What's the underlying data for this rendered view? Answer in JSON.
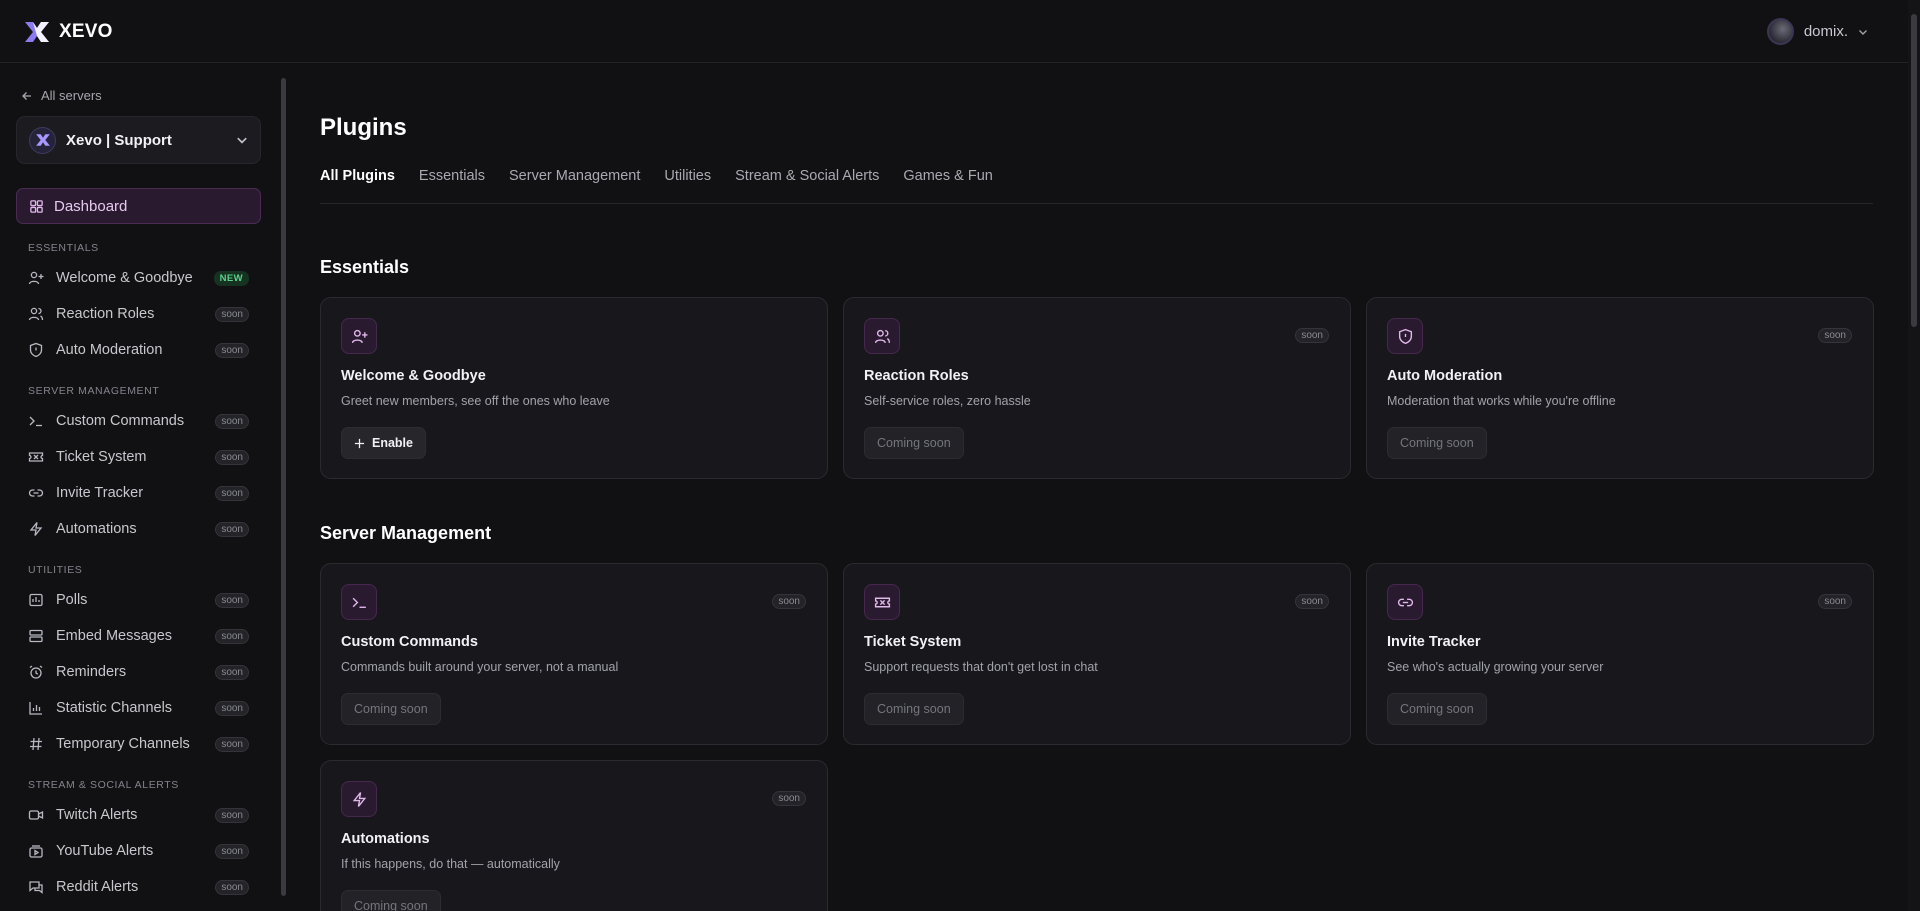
{
  "brand": {
    "name": "XEVO"
  },
  "user": {
    "name": "domix."
  },
  "sidebar": {
    "back_label": "All servers",
    "server_name": "Xevo | Support",
    "dashboard_label": "Dashboard",
    "sections": {
      "essentials": "ESSENTIALS",
      "server_management": "SERVER MANAGEMENT",
      "utilities": "UTILITIES",
      "stream_alerts": "STREAM & SOCIAL ALERTS"
    },
    "items": [
      {
        "label": "Welcome & Goodbye",
        "badge": "NEW",
        "icon": "user-plus-icon"
      },
      {
        "label": "Reaction Roles",
        "badge": "soon",
        "icon": "users-icon"
      },
      {
        "label": "Auto Moderation",
        "badge": "soon",
        "icon": "shield-icon"
      },
      {
        "label": "Custom Commands",
        "badge": "soon",
        "icon": "terminal-icon"
      },
      {
        "label": "Ticket System",
        "badge": "soon",
        "icon": "ticket-icon"
      },
      {
        "label": "Invite Tracker",
        "badge": "soon",
        "icon": "link-icon"
      },
      {
        "label": "Automations",
        "badge": "soon",
        "icon": "bolt-icon"
      },
      {
        "label": "Polls",
        "badge": "soon",
        "icon": "poll-icon"
      },
      {
        "label": "Embed Messages",
        "badge": "soon",
        "icon": "embed-icon"
      },
      {
        "label": "Reminders",
        "badge": "soon",
        "icon": "alarm-icon"
      },
      {
        "label": "Statistic Channels",
        "badge": "soon",
        "icon": "chart-icon"
      },
      {
        "label": "Temporary Channels",
        "badge": "soon",
        "icon": "hash-icon"
      },
      {
        "label": "Twitch Alerts",
        "badge": "soon",
        "icon": "video-icon"
      },
      {
        "label": "YouTube Alerts",
        "badge": "soon",
        "icon": "youtube-icon"
      },
      {
        "label": "Reddit Alerts",
        "badge": "soon",
        "icon": "chat-icon"
      }
    ]
  },
  "main": {
    "title": "Plugins",
    "tabs": [
      "All Plugins",
      "Essentials",
      "Server Management",
      "Utilities",
      "Stream & Social Alerts",
      "Games & Fun"
    ],
    "essentials_title": "Essentials",
    "server_management_title": "Server Management",
    "cards": [
      {
        "name": "Welcome & Goodbye",
        "desc": "Greet new members, see off the ones who leave",
        "button": "Enable",
        "badge": ""
      },
      {
        "name": "Reaction Roles",
        "desc": "Self-service roles, zero hassle",
        "button": "Coming soon",
        "badge": "soon"
      },
      {
        "name": "Auto Moderation",
        "desc": "Moderation that works while you're offline",
        "button": "Coming soon",
        "badge": "soon"
      },
      {
        "name": "Custom Commands",
        "desc": "Commands built around your server, not a manual",
        "button": "Coming soon",
        "badge": "soon"
      },
      {
        "name": "Ticket System",
        "desc": "Support requests that don't get lost in chat",
        "button": "Coming soon",
        "badge": "soon"
      },
      {
        "name": "Invite Tracker",
        "desc": "See who's actually growing your server",
        "button": "Coming soon",
        "badge": "soon"
      },
      {
        "name": "Automations",
        "desc": "If this happens, do that — automatically",
        "button": "Coming soon",
        "badge": "soon"
      }
    ]
  },
  "colors": {
    "accent": "#c77ad8",
    "background": "#111114",
    "card": "#18181c"
  }
}
